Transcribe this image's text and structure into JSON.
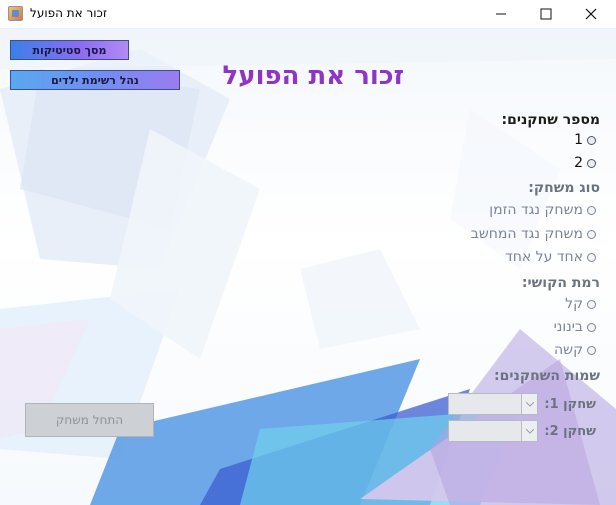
{
  "window": {
    "title": "זכור את הפועל",
    "controls": [
      "minimize-icon",
      "maximize-icon",
      "close-icon"
    ]
  },
  "toolbar": {
    "stats_button": "מסך סטיטיקות",
    "kids_button": "נהל רשימת ילדים"
  },
  "main": {
    "title": "זכור את הפועל"
  },
  "players_count": {
    "label": "מספר שחקנים:",
    "options": [
      "1",
      "2"
    ]
  },
  "game_type": {
    "label": "סוג משחק:",
    "options": [
      "משחק נגד הזמן",
      "משחק נגד המחשב",
      "אחד על אחד"
    ]
  },
  "difficulty": {
    "label": "רמת הקושי:",
    "options": [
      "קל",
      "בינוני",
      "קשה"
    ]
  },
  "player_names": {
    "label": "שמות השחקנים:",
    "player1_label": "שחקן 1:",
    "player2_label": "שחקן 2:",
    "player1_value": "",
    "player2_value": ""
  },
  "actions": {
    "start_button": "התחל משחק"
  },
  "colors": {
    "title_purple": "#8e35c8",
    "button_blue": "#3b7fe8",
    "button_violet": "#8c6cf2"
  }
}
